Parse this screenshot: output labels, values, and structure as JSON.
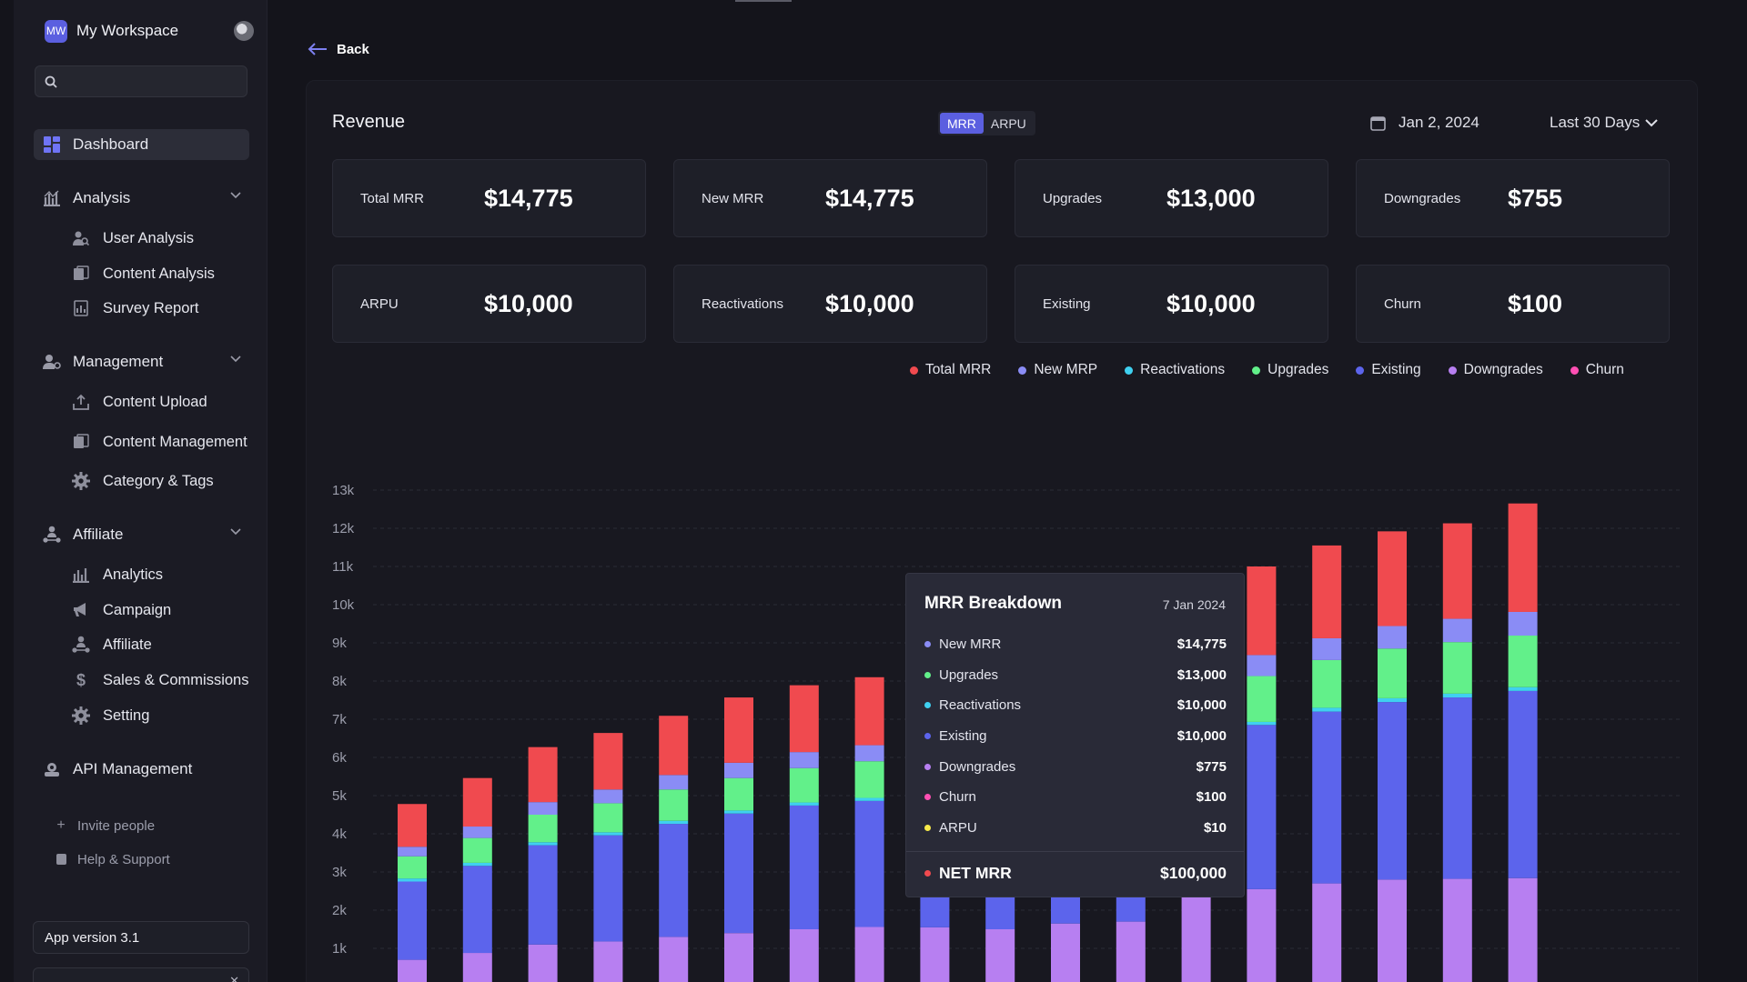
{
  "workspace": {
    "initials": "MW",
    "name": "My Workspace"
  },
  "search": {
    "placeholder": ""
  },
  "sidebar": {
    "dashboard": "Dashboard",
    "analysis": "Analysis",
    "analysis_items": [
      "User Analysis",
      "Content Analysis",
      "Survey Report"
    ],
    "management": "Management",
    "management_items": [
      "Content Upload",
      "Content Management",
      "Category & Tags"
    ],
    "affiliate": "Affiliate",
    "affiliate_items": [
      "Analytics",
      "Campaign",
      "Affiliate",
      "Sales & Commissions",
      "Setting"
    ],
    "api": "API Management",
    "invite": "Invite people",
    "help": "Help & Support",
    "version": "App version 3.1"
  },
  "main": {
    "back": "Back",
    "title": "Revenue",
    "toggle": [
      "MRR",
      "ARPU"
    ],
    "date": "Jan 2, 2024",
    "range": "Last 30 Days",
    "stats": [
      {
        "label": "Total MRR",
        "value": "$14,775"
      },
      {
        "label": "New MRR",
        "value": "$14,775"
      },
      {
        "label": "Upgrades",
        "value": "$13,000"
      },
      {
        "label": "Downgrades",
        "value": "$755"
      },
      {
        "label": "ARPU",
        "value": "$10,000"
      },
      {
        "label": "Reactivations",
        "value": "$10,000"
      },
      {
        "label": "Existing",
        "value": "$10,000"
      },
      {
        "label": "Churn",
        "value": "$100"
      }
    ]
  },
  "legend": [
    {
      "name": "Total MRR",
      "color": "#f04a4f"
    },
    {
      "name": "New MRP",
      "color": "#8a8cf5"
    },
    {
      "name": "Reactivations",
      "color": "#3fd0f0"
    },
    {
      "name": "Upgrades",
      "color": "#62f08a"
    },
    {
      "name": "Existing",
      "color": "#5c64ec"
    },
    {
      "name": "Downgrades",
      "color": "#b77ff1"
    },
    {
      "name": "Churn",
      "color": "#ff4fb3"
    }
  ],
  "tooltip": {
    "title": "MRR Breakdown",
    "date": "7 Jan 2024",
    "rows": [
      {
        "label": "New MRR",
        "value": "$14,775",
        "color": "#8a8cf5"
      },
      {
        "label": "Upgrades",
        "value": "$13,000",
        "color": "#62f08a"
      },
      {
        "label": "Reactivations",
        "value": "$10,000",
        "color": "#3fd0f0"
      },
      {
        "label": "Existing",
        "value": "$10,000",
        "color": "#5c64ec"
      },
      {
        "label": "Downgrades",
        "value": "$775",
        "color": "#b77ff1"
      },
      {
        "label": "Churn",
        "value": "$100",
        "color": "#ff4fb3"
      },
      {
        "label": "ARPU",
        "value": "$10",
        "color": "#f6e94a"
      }
    ],
    "net_label": "NET MRR",
    "net_value": "$100,000",
    "net_color": "#f04a4f"
  },
  "chart_data": {
    "type": "bar",
    "stacked": true,
    "y_ticks": [
      "1k",
      "2k",
      "3k",
      "4k",
      "5k",
      "6k",
      "7k",
      "8k",
      "9k",
      "10k",
      "11k",
      "12k",
      "13k"
    ],
    "ylim": [
      0,
      13000
    ],
    "grid": true,
    "series_order": [
      "Downgrades",
      "Existing",
      "Reactivations",
      "Upgrades",
      "New MRP",
      "Total MRR"
    ],
    "series_colors": [
      "#b77ff1",
      "#5c64ec",
      "#3fd0f0",
      "#62f08a",
      "#8a8cf5",
      "#f04a4f"
    ],
    "bars": [
      [
        700,
        2050,
        80,
        580,
        250,
        1120
      ],
      [
        880,
        2280,
        80,
        650,
        300,
        1270
      ],
      [
        1100,
        2600,
        80,
        720,
        330,
        1440
      ],
      [
        1180,
        2780,
        80,
        760,
        360,
        1480
      ],
      [
        1300,
        2960,
        80,
        820,
        380,
        1550
      ],
      [
        1400,
        3130,
        80,
        850,
        400,
        1710
      ],
      [
        1500,
        3240,
        80,
        900,
        420,
        1750
      ],
      [
        1560,
        3300,
        80,
        960,
        420,
        1780
      ],
      [
        1550,
        3300,
        80,
        960,
        420,
        1780
      ],
      [
        1500,
        3350,
        80,
        950,
        450,
        1810
      ],
      [
        1650,
        3400,
        80,
        950,
        450,
        1870
      ],
      [
        1700,
        3450,
        80,
        950,
        450,
        1840
      ],
      [
        2450,
        4150,
        80,
        1200,
        530,
        2240
      ],
      [
        2550,
        4300,
        80,
        1200,
        550,
        2320
      ],
      [
        2700,
        4500,
        100,
        1250,
        570,
        2430
      ],
      [
        2800,
        4650,
        100,
        1300,
        590,
        2480
      ],
      [
        2820,
        4750,
        100,
        1350,
        610,
        2500
      ],
      [
        2840,
        4900,
        100,
        1350,
        620,
        2840
      ]
    ]
  }
}
